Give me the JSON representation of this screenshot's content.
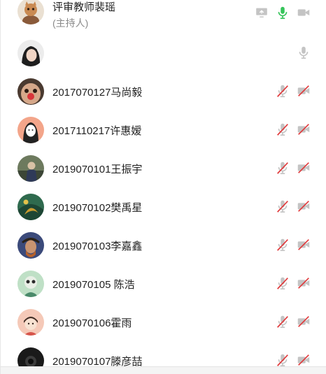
{
  "colors": {
    "mic_active": "#35c45a",
    "muted": "#e0383a",
    "icon_gray": "#c4c4c4"
  },
  "host": {
    "name": "评审教师裴瑶",
    "role": "(主持人)",
    "icons": [
      "screen-share-icon",
      "mic-on-icon",
      "camera-icon"
    ]
  },
  "participants": [
    {
      "name": "",
      "icons": [
        "mic-icon"
      ]
    },
    {
      "name": "2017070127马尚毅",
      "icons": [
        "mic-off-icon",
        "camera-off-icon"
      ]
    },
    {
      "name": "2017110217许惠嫒",
      "icons": [
        "mic-off-icon",
        "camera-off-icon"
      ]
    },
    {
      "name": "2019070101王振宇",
      "icons": [
        "mic-off-icon",
        "camera-off-icon"
      ]
    },
    {
      "name": "2019070102樊禹星",
      "icons": [
        "mic-off-icon",
        "camera-off-icon"
      ]
    },
    {
      "name": "2019070103李嘉鑫",
      "icons": [
        "mic-off-icon",
        "camera-off-icon"
      ]
    },
    {
      "name": "2019070105 陈浩",
      "icons": [
        "mic-off-icon",
        "camera-off-icon"
      ]
    },
    {
      "name": "2019070106霍雨",
      "icons": [
        "mic-off-icon",
        "camera-off-icon"
      ]
    },
    {
      "name": "2019070107滕彦喆",
      "icons": [
        "mic-off-icon",
        "camera-off-icon"
      ]
    }
  ]
}
